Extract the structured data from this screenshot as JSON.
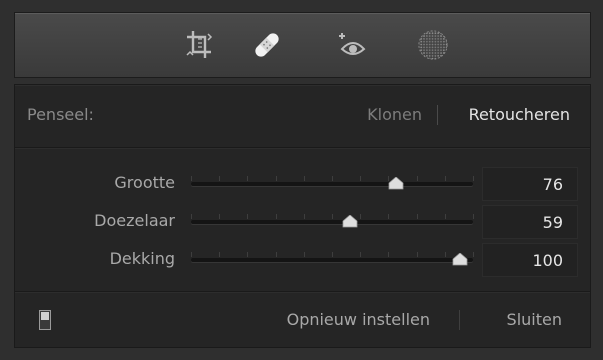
{
  "toolbar": {
    "tools": [
      {
        "icon": "crop-rotate-icon",
        "active": false
      },
      {
        "icon": "bandage-heal-icon",
        "active": true
      },
      {
        "icon": "red-eye-icon",
        "active": false
      },
      {
        "icon": "radial-filter-icon",
        "active": false
      }
    ]
  },
  "brush": {
    "label": "Penseel:",
    "modes": [
      "Klonen",
      "Retoucheren"
    ],
    "selected": "Retoucheren"
  },
  "sliders": [
    {
      "label": "Grootte",
      "value": "76",
      "fraction": 0.76
    },
    {
      "label": "Doezelaar",
      "value": "59",
      "fraction": 0.59
    },
    {
      "label": "Dekking",
      "value": "100",
      "fraction": 1.0
    }
  ],
  "footer": {
    "reset_label": "Opnieuw instellen",
    "close_label": "Sluiten"
  },
  "colors": {
    "panel_bg": "#2f2f2f",
    "text_active": "#e4e4e4",
    "text_dim": "#7d7d7d"
  }
}
